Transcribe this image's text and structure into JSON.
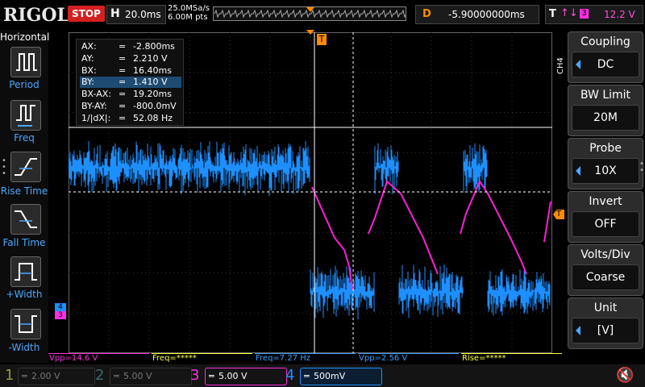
{
  "brand": "RIGOL",
  "run_state": "STOP",
  "timebase": {
    "label": "H",
    "value": "20.0ms"
  },
  "sample": {
    "rate": "25.0MSa/s",
    "points": "6.00M pts"
  },
  "delay": {
    "label": "D",
    "value": "-5.90000000ms"
  },
  "trigger": {
    "label": "T",
    "edge": "↑↓",
    "source": "3",
    "level": "12.2 V"
  },
  "horizontal_menu": {
    "title": "Horizontal",
    "items": [
      "Period",
      "Freq",
      "Rise Time",
      "Fall Time",
      "+Width",
      "-Width"
    ]
  },
  "cursor": {
    "rows": [
      {
        "name": "AX:",
        "eq": "=",
        "value": "-2.800ms"
      },
      {
        "name": "AY:",
        "eq": "=",
        "value": "2.210 V"
      },
      {
        "name": "BX:",
        "eq": "=",
        "value": "16.40ms"
      },
      {
        "name": "BY:",
        "eq": "=",
        "value": "1.410 V"
      },
      {
        "name": "BX-AX:",
        "eq": "=",
        "value": "19.20ms"
      },
      {
        "name": "BY-AY:",
        "eq": "=",
        "value": "-800.0mV"
      },
      {
        "name": "1/|dX|:",
        "eq": "=",
        "value": "52.08 Hz"
      }
    ]
  },
  "channel_menu": {
    "tag": "CH4",
    "items": [
      {
        "title": "Coupling",
        "value": "DC"
      },
      {
        "title": "BW Limit",
        "value": "20M"
      },
      {
        "title": "Probe",
        "value": "10X"
      },
      {
        "title": "Invert",
        "value": "OFF"
      },
      {
        "title": "Volts/Div",
        "value": "Coarse"
      },
      {
        "title": "Unit",
        "value": "[V]"
      }
    ]
  },
  "measurements": [
    {
      "text": "Vpp=14.6 V",
      "color": "#ff2ee0"
    },
    {
      "text": "Freq=*****",
      "color": "#ffff3b"
    },
    {
      "text": "Freq=7.27 Hz",
      "color": "#3aa0ff"
    },
    {
      "text": "Vpp=2.56 V",
      "color": "#3aa0ff"
    },
    {
      "text": "Rise=*****",
      "color": "#ffff3b"
    }
  ],
  "channels": [
    {
      "num": "1",
      "scale": "2.00 V",
      "color": "#9a9a30",
      "active": false
    },
    {
      "num": "2",
      "scale": "5.00 V",
      "color": "#3c6b6b",
      "active": false
    },
    {
      "num": "3",
      "scale": "5.00 V",
      "color": "#ff2ee0",
      "active": true
    },
    {
      "num": "4",
      "scale": "500mV",
      "color": "#1e8fff",
      "active": true
    }
  ],
  "markers": {
    "trigger": "T",
    "ch3": "3",
    "ch4": "4"
  },
  "colors": {
    "ch4_trace": "#1e8fff",
    "ch3_trace": "#ff1ed8",
    "trigger": "#ff8c00",
    "grid": "#555555",
    "run_stop": "#d42020"
  }
}
